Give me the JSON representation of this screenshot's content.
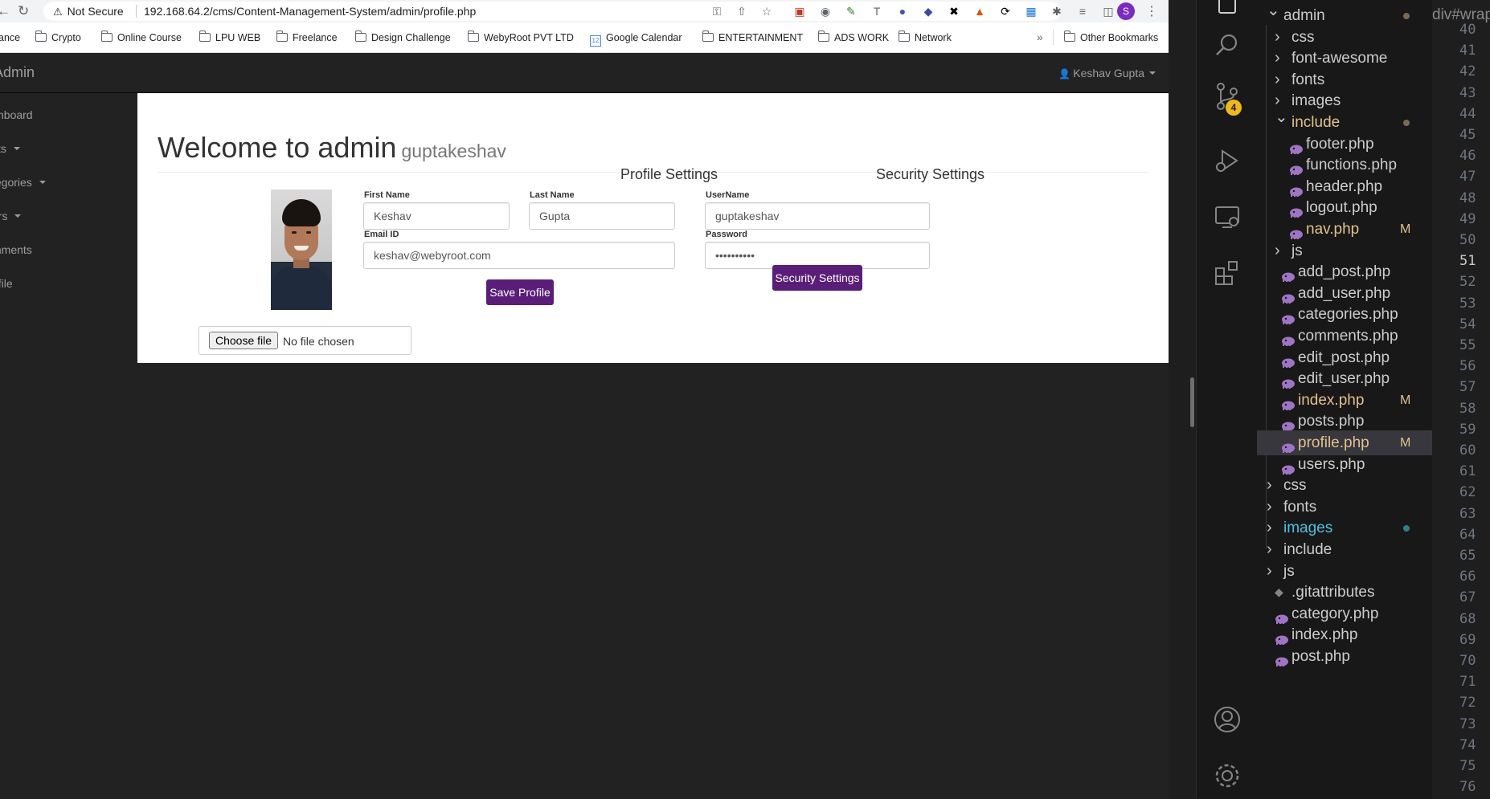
{
  "browser": {
    "security_label": "Not Secure",
    "url": "192.168.64.2/cms/Content-Management-System/admin/profile.php",
    "profile_initial": "S",
    "bookmarks": [
      {
        "label": "ance"
      },
      {
        "label": "Crypto"
      },
      {
        "label": "Online Course"
      },
      {
        "label": "LPU WEB"
      },
      {
        "label": "Freelance"
      },
      {
        "label": "Design Challenge"
      },
      {
        "label": "WebyRoot PVT LTD"
      },
      {
        "label": "Google Calendar"
      },
      {
        "label": "ENTERTAINMENT"
      },
      {
        "label": "ADS WORK"
      },
      {
        "label": "Network"
      },
      {
        "label": "Other Bookmarks"
      }
    ],
    "more_label": "»"
  },
  "cms": {
    "brand": "Admin",
    "user_menu": "Keshav Gupta",
    "sidebar": [
      {
        "label": "shboard",
        "has_caret": false
      },
      {
        "label": "sts",
        "has_caret": true
      },
      {
        "label": "tegories",
        "has_caret": true
      },
      {
        "label": "ers",
        "has_caret": true
      },
      {
        "label": "mments",
        "has_caret": false
      },
      {
        "label": "ofile",
        "has_caret": false
      }
    ],
    "page_title": "Welcome to admin",
    "page_subtitle": "guptakeshav",
    "profile_section_title": "Profile Settings",
    "security_section_title": "Security Settings",
    "file_button": "Choose file",
    "file_status": "No file chosen",
    "form": {
      "first_name_label": "First Name",
      "first_name_value": "Keshav",
      "last_name_label": "Last Name",
      "last_name_value": "Gupta",
      "email_label": "Email ID",
      "email_value": "keshav@webyroot.com",
      "username_label": "UserName",
      "username_value": "guptakeshav",
      "password_label": "Password",
      "password_value": "••••••••••",
      "save_button": "Save Profile",
      "security_button": "Security Settings"
    },
    "accent_color": "#5a1e78"
  },
  "vscode": {
    "scm_badge": "4",
    "breadcrumb": "div#wrap",
    "tree": [
      {
        "name": "admin",
        "type": "folder",
        "open": true,
        "depth": 0,
        "modified_dot": true
      },
      {
        "name": "css",
        "type": "folder",
        "open": false,
        "depth": 1
      },
      {
        "name": "font-awesome",
        "type": "folder",
        "open": false,
        "depth": 1
      },
      {
        "name": "fonts",
        "type": "folder",
        "open": false,
        "depth": 1
      },
      {
        "name": "images",
        "type": "folder",
        "open": false,
        "depth": 1
      },
      {
        "name": "include",
        "type": "folder",
        "open": true,
        "depth": 1,
        "highlight": "modified",
        "modified_dot": true
      },
      {
        "name": "footer.php",
        "type": "php",
        "depth": 2
      },
      {
        "name": "functions.php",
        "type": "php",
        "depth": 2
      },
      {
        "name": "header.php",
        "type": "php",
        "depth": 2
      },
      {
        "name": "logout.php",
        "type": "php",
        "depth": 2
      },
      {
        "name": "nav.php",
        "type": "php",
        "depth": 2,
        "highlight": "modified",
        "status": "M"
      },
      {
        "name": "js",
        "type": "folder",
        "open": false,
        "depth": 1
      },
      {
        "name": "add_post.php",
        "type": "php",
        "depth": 1
      },
      {
        "name": "add_user.php",
        "type": "php",
        "depth": 1
      },
      {
        "name": "categories.php",
        "type": "php",
        "depth": 1
      },
      {
        "name": "comments.php",
        "type": "php",
        "depth": 1
      },
      {
        "name": "edit_post.php",
        "type": "php",
        "depth": 1
      },
      {
        "name": "edit_user.php",
        "type": "php",
        "depth": 1
      },
      {
        "name": "index.php",
        "type": "php",
        "depth": 1,
        "highlight": "modified",
        "status": "M"
      },
      {
        "name": "posts.php",
        "type": "php",
        "depth": 1
      },
      {
        "name": "profile.php",
        "type": "php",
        "depth": 1,
        "highlight": "modified",
        "status": "M",
        "active": true
      },
      {
        "name": "users.php",
        "type": "php",
        "depth": 1
      },
      {
        "name": "css",
        "type": "folder",
        "open": false,
        "depth": 0
      },
      {
        "name": "fonts",
        "type": "folder",
        "open": false,
        "depth": 0
      },
      {
        "name": "images",
        "type": "folder",
        "open": false,
        "depth": 0,
        "highlight": "untracked",
        "untracked_dot": true
      },
      {
        "name": "include",
        "type": "folder",
        "open": false,
        "depth": 0
      },
      {
        "name": "js",
        "type": "folder",
        "open": false,
        "depth": 0
      },
      {
        "name": ".gitattributes",
        "type": "git",
        "depth": 0
      },
      {
        "name": "category.php",
        "type": "php",
        "depth": 0
      },
      {
        "name": "index.php",
        "type": "php",
        "depth": 0
      },
      {
        "name": "post.php",
        "type": "php",
        "depth": 0
      }
    ],
    "line_numbers": [
      "40",
      "41",
      "42",
      "43",
      "44",
      "45",
      "46",
      "47",
      "48",
      "49",
      "50",
      "51",
      "52",
      "53",
      "54",
      "55",
      "56",
      "57",
      "58",
      "59",
      "60",
      "61",
      "62",
      "63",
      "64",
      "65",
      "66",
      "67",
      "68",
      "69",
      "70",
      "71",
      "72",
      "73",
      "74",
      "75",
      "76"
    ],
    "current_line": "51"
  },
  "icons": {
    "back": "back-arrow-icon",
    "reload": "reload-icon",
    "warning": "warning-icon",
    "key": "key-icon",
    "share": "share-icon",
    "star": "star-icon",
    "folder": "folder-icon",
    "user": "user-icon",
    "php": "php-elephant-icon",
    "search": "search-icon",
    "source_control": "source-control-icon",
    "run_debug": "run-debug-icon",
    "remote": "remote-explorer-icon",
    "extensions": "extensions-icon",
    "account": "account-icon",
    "settings": "settings-gear-icon"
  }
}
